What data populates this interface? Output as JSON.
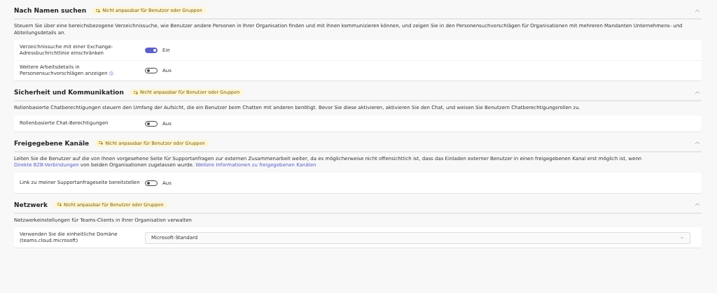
{
  "sections": [
    {
      "title": "Nach Namen suchen",
      "badge": "Nicht anpassbar für Benutzer oder Gruppen",
      "expanded": true,
      "description": [
        {
          "kind": "text",
          "text": "Steuern Sie über eine bereichsbezogene Verzeichnissuche, wie Benutzer andere Personen in Ihrer Organisation finden und mit ihnen kommunizieren können, und zeigen Sie in den Personensuchvorschlägen für Organisationen mit mehreren Mandanten Unternehmens- und Abteilungsdetails an."
        }
      ],
      "rows": [
        {
          "kind": "toggle",
          "label": "Verzeichnissuche mit einer Exchange-Adressbuchrichtlinie einschränken",
          "on": true,
          "status": "Ein",
          "info": false
        },
        {
          "kind": "toggle",
          "label": "Weitere Arbeitsdetails in Personensuchvorschlägen anzeigen",
          "on": false,
          "status": "Aus",
          "info": true
        }
      ]
    },
    {
      "title": "Sicherheit und Kommunikation",
      "badge": "Nicht anpassbar für Benutzer oder Gruppen",
      "expanded": true,
      "description": [
        {
          "kind": "text",
          "text": "Rollenbasierte Chatberechtigungen steuern den Umfang der Aufsicht, die ein Benutzer beim Chatten mit anderen benötigt. Bevor Sie diese aktivieren, aktivieren Sie den Chat, und weisen Sie Benutzern Chatberechtigungsrollen zu."
        }
      ],
      "rows": [
        {
          "kind": "toggle",
          "label": "Rollenbasierte Chat-Berechtigungen",
          "on": false,
          "status": "Aus",
          "info": false
        }
      ]
    },
    {
      "title": "Freigegebene Kanäle",
      "badge": "Nicht anpassbar für Benutzer oder Gruppen",
      "expanded": true,
      "description": [
        {
          "kind": "text",
          "text": "Leiten Sie die Benutzer auf die von Ihnen vorgesehene Seite für Supportanfragen zur externen Zusammenarbeit weiter, da es möglicherweise nicht offensichtlich ist, dass das Einladen externer Benutzer in einen freigegebenen Kanal erst möglich ist, wenn "
        },
        {
          "kind": "link",
          "text": "Direkte B2B-Verbindungen"
        },
        {
          "kind": "text",
          "text": " von beiden Organisationen zugelassen wurde. "
        },
        {
          "kind": "link",
          "text": "Weitere Informationen zu freigegebenen Kanälen"
        }
      ],
      "rows": [
        {
          "kind": "toggle",
          "label": "Link zu meiner Supportanfrageseite bereitstellen",
          "on": false,
          "status": "Aus",
          "info": false
        }
      ]
    },
    {
      "title": "Netzwerk",
      "badge": "Nicht anpassbar für Benutzer oder Gruppen",
      "expanded": true,
      "description": [
        {
          "kind": "text",
          "text": "Netzwerkeinstellungen für Teams-Clients in Ihrer Organisation verwalten"
        }
      ],
      "rows": [
        {
          "kind": "dropdown",
          "label": "Verwenden Sie die einheitliche Domäne (teams.cloud.microsoft)",
          "value": "Microsoft-Standard"
        }
      ]
    }
  ]
}
